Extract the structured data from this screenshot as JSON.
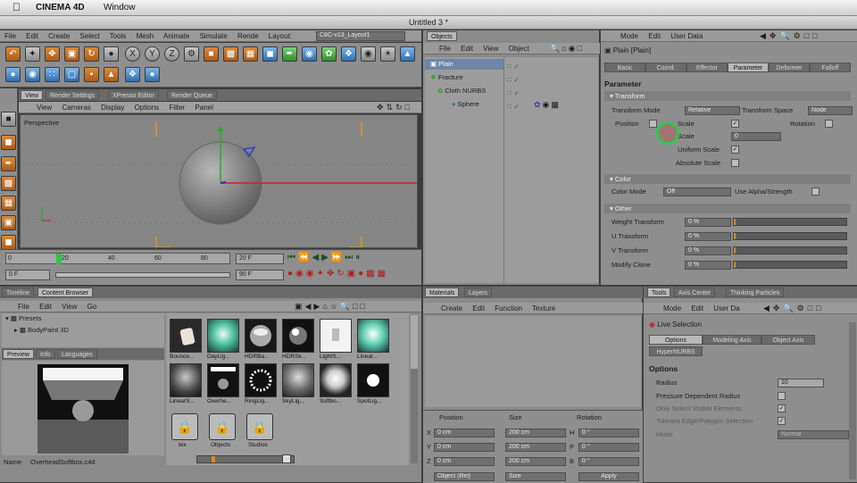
{
  "mac_menu": {
    "app": "CINEMA 4D",
    "window": "Window"
  },
  "window_title": "Untitled 3 *",
  "main_menu": [
    "File",
    "Edit",
    "Create",
    "Select",
    "Tools",
    "Mesh",
    "Animate",
    "Simulate",
    "Rende",
    "Layout:"
  ],
  "layout_value": "C8C-v13_Layout1",
  "viewport": {
    "tabs": [
      "View",
      "Render Settings",
      "XPresso Editor",
      "Render Queue"
    ],
    "menu": [
      "View",
      "Cameras",
      "Display",
      "Options",
      "Filter",
      "Panel"
    ],
    "label": "Perspective"
  },
  "timeline": {
    "ticks": [
      "0",
      "20",
      "40",
      "60",
      "80"
    ],
    "current_frame": "20 F",
    "start_frame": "0 F",
    "end_frame": "90 F"
  },
  "objects": {
    "tab": "Objects",
    "menu": [
      "File",
      "Edit",
      "View",
      "Object"
    ],
    "items": [
      "Plain",
      "Fracture",
      "Cloth NURBS",
      "Sphere"
    ]
  },
  "attributes": {
    "menu": [
      "Mode",
      "Edit",
      "User Data"
    ],
    "title": "Plain [Plain]",
    "tabs": [
      "Basic",
      "Coord.",
      "Effector",
      "Parameter",
      "Deformer",
      "Falloff"
    ],
    "section_parameter": "Parameter",
    "transform_header": "Transform",
    "transform_mode_label": "Transform Mode",
    "transform_mode_value": "Relative",
    "transform_space_label": "Transform Space",
    "transform_space_value": "Node",
    "position_label": "Position",
    "scale_label": "Scale",
    "rotation_label": "Rotation",
    "scale_field_label": "Scale",
    "scale_field_value": "0",
    "uniform_scale_label": "Uniform Scale",
    "absolute_scale_label": "Absolute Scale",
    "color_header": "Color",
    "color_mode_label": "Color Mode",
    "color_mode_value": "Off",
    "use_alpha_label": "Use Alpha/Strength",
    "other_header": "Other",
    "weight_label": "Weight Transform",
    "weight_value": "0 %",
    "u_label": "U Transform",
    "u_value": "0 %",
    "v_label": "V Transform",
    "v_value": "0 %",
    "modify_label": "Modify Clone",
    "modify_value": "0 %"
  },
  "content_browser": {
    "tabs": [
      "Timeline",
      "Content Browser"
    ],
    "menu": [
      "File",
      "Edit",
      "View",
      "Go"
    ],
    "tree": [
      "Presets",
      "BodyPaint 3D"
    ],
    "preview_tabs": [
      "Preview",
      "Info",
      "Languages"
    ],
    "name_label": "Name",
    "name_value": "OverheadSoftbox.c4d",
    "thumbs_row1": [
      "Bounce...",
      "DayLig...",
      "HDRBa...",
      "HDRSk...",
      "LightS...",
      "Linear..."
    ],
    "thumbs_row2": [
      "LinearS...",
      "Overhe...",
      "RingLig...",
      "SkyLig...",
      "Softbo...",
      "SpotLig..."
    ],
    "thumbs_row3": [
      "tex",
      "Objects",
      "Studios"
    ]
  },
  "materials": {
    "tabs": [
      "Materials",
      "Layers"
    ],
    "menu": [
      "Create",
      "Edit",
      "Function",
      "Texture"
    ]
  },
  "coordinates": {
    "headers": [
      "Position",
      "Size",
      "Rotation"
    ],
    "rows": [
      {
        "axis": "X",
        "pos": "0 cm",
        "size": "200 cm",
        "rot_axis": "H",
        "rot": "0 °"
      },
      {
        "axis": "Y",
        "pos": "0 cm",
        "size": "200 cm",
        "rot_axis": "P",
        "rot": "0 °"
      },
      {
        "axis": "Z",
        "pos": "0 cm",
        "size": "200 cm",
        "rot_axis": "B",
        "rot": "0 °"
      }
    ],
    "object_mode": "Object (Rel)",
    "size_mode": "Size",
    "apply": "Apply"
  },
  "tools": {
    "tabs": [
      "Tools",
      "Axis Center",
      "Thinking Particles"
    ],
    "menu": [
      "Mode",
      "Edit",
      "User Da"
    ],
    "title": "Live Selection",
    "subtabs": [
      "Options",
      "Modeling Axis",
      "Object Axis",
      "HyperNURBS"
    ],
    "section": "Options",
    "radius_label": "Radius",
    "radius_value": "10",
    "pressure_label": "Pressure Dependent Radius",
    "only_visible_label": "Only Select Visible Elements",
    "tolerant_label": "Tolerant Edge/Polygon Selection",
    "mode_label": "Mode",
    "mode_value": "Normal"
  }
}
